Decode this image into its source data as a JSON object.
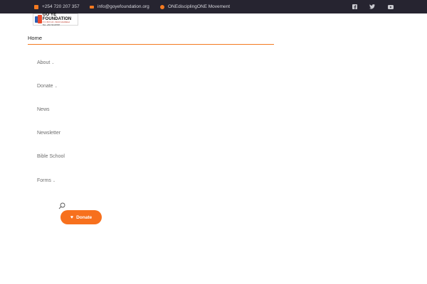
{
  "topbar": {
    "phone": "+254 720 207 357",
    "email": "info@goyefoundation.org",
    "movement": "ONEdisciplingONE Movement",
    "phone_icon": "phone-icon",
    "email_icon": "envelope-icon",
    "movement_icon": "globe-icon",
    "social": [
      "facebook-icon",
      "twitter-icon",
      "youtube-icon"
    ]
  },
  "logo": {
    "title": "GO YE FOUNDATION",
    "subtitle": "P. O. BOX 123 - 50100 KAKAMEGA",
    "tagline": "TEL: +254 720 207357"
  },
  "nav": {
    "home": "Home",
    "items": [
      {
        "label": "About",
        "has_dropdown": true
      },
      {
        "label": "Donate",
        "has_dropdown": true
      },
      {
        "label": "News",
        "has_dropdown": false
      },
      {
        "label": "Newsletter",
        "has_dropdown": false
      },
      {
        "label": "Bible School",
        "has_dropdown": false
      },
      {
        "label": "Forms",
        "has_dropdown": true
      }
    ],
    "chevron": "⌄"
  },
  "donate_button": {
    "label": "Donate",
    "icon": "♥"
  },
  "colors": {
    "accent": "#f47a20",
    "topbar_bg": "#262430",
    "button_bg": "#f7701d"
  }
}
